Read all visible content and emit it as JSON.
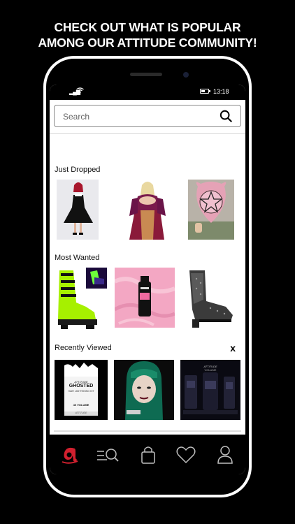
{
  "header": {
    "line1": "CHECK OUT WHAT IS POPULAR",
    "line2": "AMONG OUR ATTITUDE COMMUNITY!"
  },
  "status_bar": {
    "time": "13:18"
  },
  "search": {
    "placeholder": "Search"
  },
  "sections": {
    "just_dropped": {
      "title": "Just Dropped",
      "items": [
        "black-collared-dress",
        "burgundy-velvet-gown",
        "pink-pentagram-bag"
      ]
    },
    "most_wanted": {
      "title": "Most Wanted",
      "items": [
        "green-neon-platform-boots",
        "pink-hair-dye-bottle",
        "studded-western-boots"
      ]
    },
    "recently_viewed": {
      "title": "Recently Viewed",
      "close_label": "x",
      "items": [
        {
          "brand": "ATTITUDE",
          "name": "GHOSTED",
          "sub": "HAIR LIGHTENING KIT",
          "volume": "40 VOLUME",
          "tag": "ATTITUDE"
        },
        {
          "brand": "",
          "name": "green-haired-model",
          "sub": "",
          "volume": "",
          "tag": ""
        },
        {
          "brand": "ATTITUDE",
          "name": "VOLUME",
          "sub": "",
          "volume": "",
          "tag": ""
        }
      ]
    }
  },
  "navbar": {
    "items": [
      "home-logo-icon",
      "search-list-icon",
      "shopping-bag-icon",
      "heart-icon",
      "user-icon"
    ]
  },
  "colors": {
    "brand_red": "#d2202f",
    "nav_icon": "#bfbfbf",
    "background": "#000000",
    "neon_green": "#a6f000",
    "pink": "#f3a7c3"
  }
}
